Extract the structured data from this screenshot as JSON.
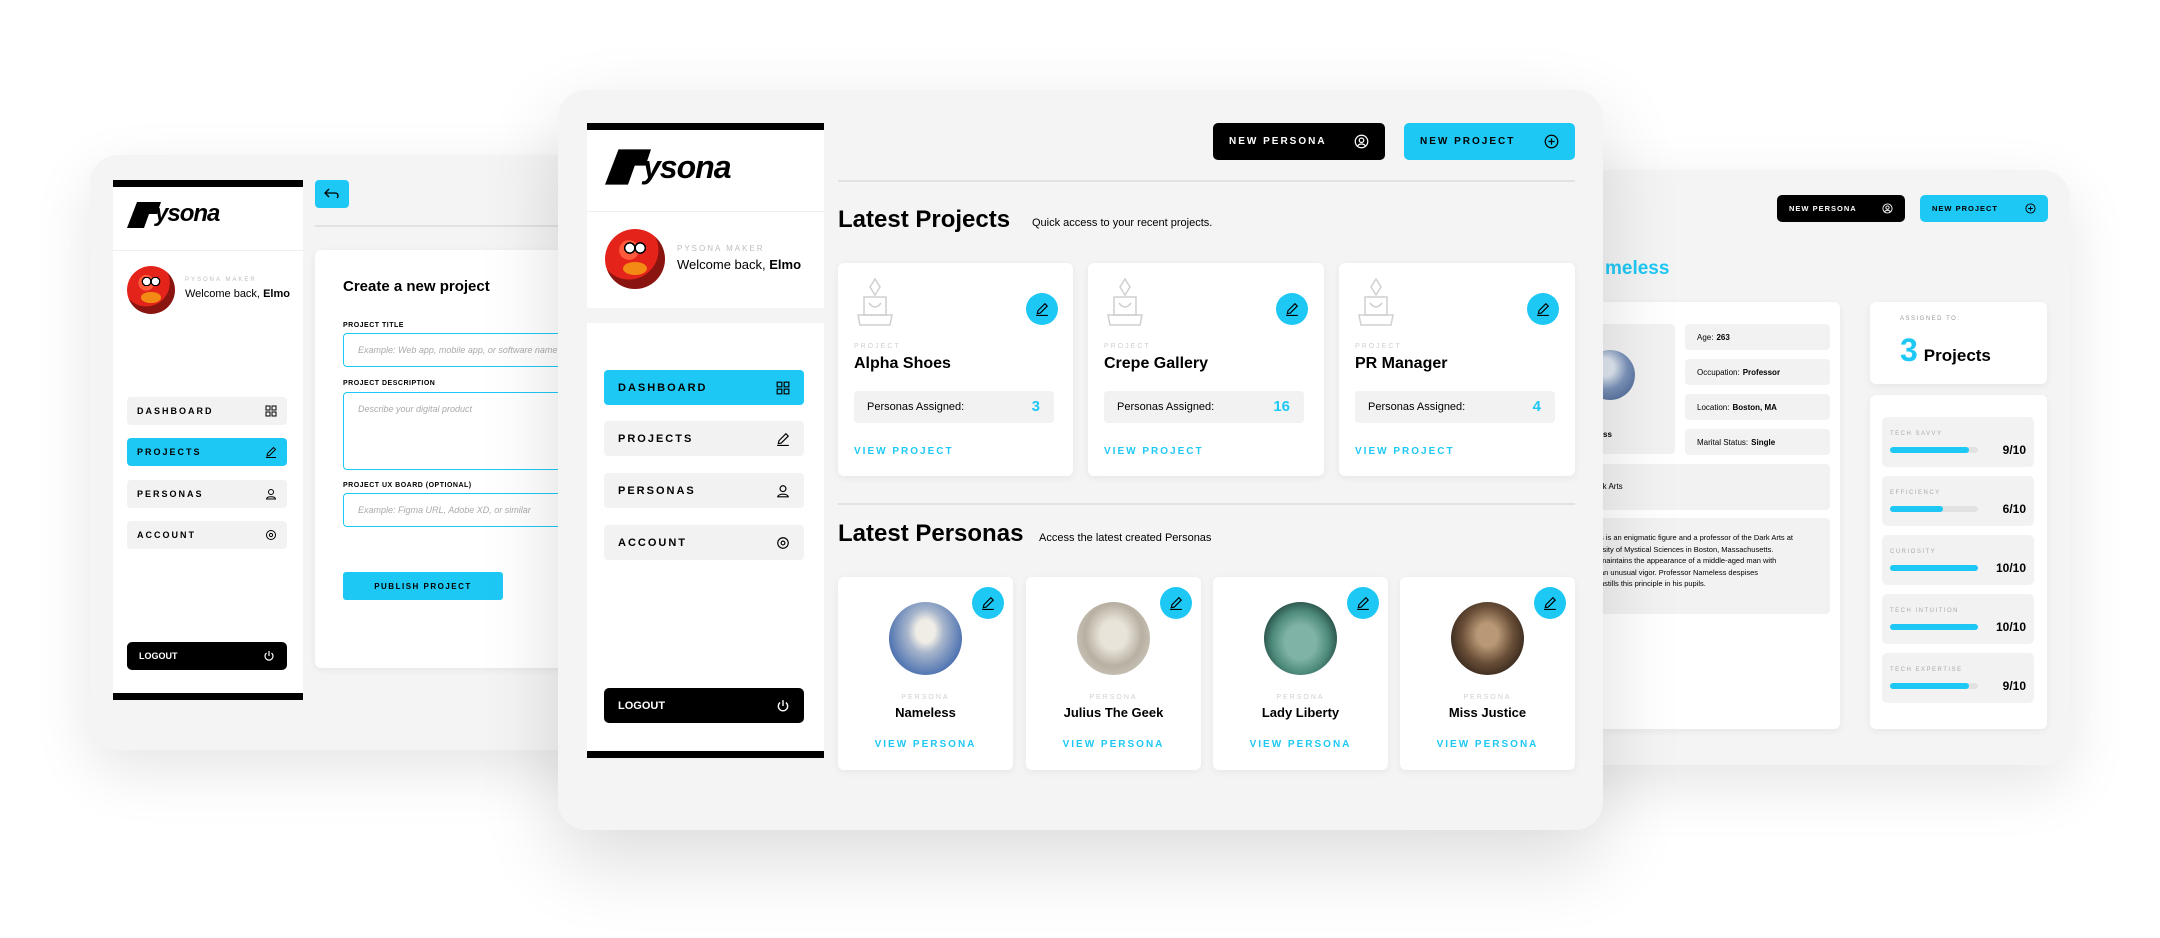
{
  "brand": {
    "name": "ysona",
    "accent": "#1ec8f5",
    "dark": "#000000"
  },
  "user": {
    "role": "PYSONA MAKER",
    "welcome": "Welcome back,",
    "name": "Elmo"
  },
  "nav": {
    "items": [
      {
        "label": "DASHBOARD",
        "icon": "grid-icon"
      },
      {
        "label": "PROJECTS",
        "icon": "pencil-icon"
      },
      {
        "label": "PERSONAS",
        "icon": "user-icon"
      },
      {
        "label": "ACCOUNT",
        "icon": "gear-icon"
      }
    ],
    "logout": "LOGOUT"
  },
  "header": {
    "new_persona": "NEW PERSONA",
    "new_project": "NEW PROJECT"
  },
  "dashboard": {
    "projects_title": "Latest Projects",
    "projects_subtitle": "Quick access to your recent projects.",
    "project_tag": "PROJECT",
    "personas_assigned_label": "Personas Assigned:",
    "view_project": "VIEW PROJECT",
    "projects": [
      {
        "name": "Alpha Shoes",
        "assigned": "3"
      },
      {
        "name": "Crepe Gallery",
        "assigned": "16"
      },
      {
        "name": "PR Manager",
        "assigned": "4"
      }
    ],
    "personas_title": "Latest Personas",
    "personas_subtitle": "Access the latest created Personas",
    "persona_tag": "PERSONA",
    "view_persona": "VIEW PERSONA",
    "personas": [
      {
        "name": "Nameless"
      },
      {
        "name": "Julius The Geek"
      },
      {
        "name": "Lady Liberty"
      },
      {
        "name": "Miss Justice"
      }
    ]
  },
  "create_project": {
    "title": "Create a new project",
    "project_title_label": "PROJECT TITLE",
    "project_title_placeholder": "Example: Web app, mobile app, or software name",
    "description_label": "PROJECT DESCRIPTION",
    "description_placeholder": "Describe your digital product",
    "ux_label": "PROJECT UX BOARD (OPTIONAL)",
    "ux_placeholder": "Example: Figma URL, Adobe XD, or similar",
    "publish": "PUBLISH PROJECT"
  },
  "persona_detail": {
    "title_fragment": "meless",
    "name_fragment": "ss",
    "age_label": "Age:",
    "age": "263",
    "occupation_label": "Occupation:",
    "occupation": "Professor",
    "location_label": "Location:",
    "location": "Boston, MA",
    "marital_label": "Marital Status:",
    "marital": "Single",
    "specialty_fragment": "rk Arts",
    "bio_lines": [
      "s is an enigmatic figure and a professor of the Dark Arts at",
      "rsity of Mystical Sciences in Boston, Massachusetts.",
      "maintains the appearance of a middle-aged man with",
      "an unusual vigor. Professor Nameless despises",
      "nstills this principle in his pupils."
    ],
    "assigned_to": "ASSIGNED TO:",
    "assigned_count": "3",
    "assigned_unit": "Projects",
    "stats": [
      {
        "label": "TECH SAVVY",
        "value": "9/10",
        "level": 0.9
      },
      {
        "label": "EFFICIENCY",
        "value": "6/10",
        "level": 0.6
      },
      {
        "label": "CURIOSITY",
        "value": "10/10",
        "level": 1.0
      },
      {
        "label": "TECH INTUITION",
        "value": "10/10",
        "level": 1.0
      },
      {
        "label": "TECH EXPERTISE",
        "value": "9/10",
        "level": 0.9
      }
    ]
  }
}
